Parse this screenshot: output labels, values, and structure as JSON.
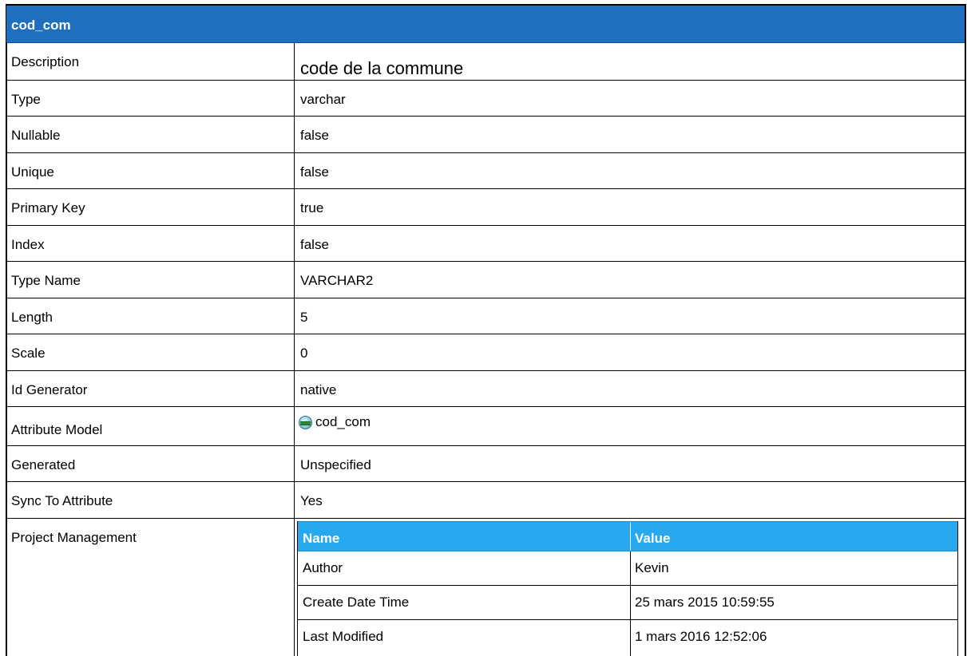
{
  "title": "cod_com",
  "properties": [
    {
      "label": "Description",
      "value": "code de la commune"
    },
    {
      "label": "Type",
      "value": "varchar"
    },
    {
      "label": "Nullable",
      "value": "false"
    },
    {
      "label": "Unique",
      "value": "false"
    },
    {
      "label": "Primary Key",
      "value": "true"
    },
    {
      "label": "Index",
      "value": "false"
    },
    {
      "label": "Type Name",
      "value": "VARCHAR2"
    },
    {
      "label": "Length",
      "value": "5"
    },
    {
      "label": "Scale",
      "value": "0"
    },
    {
      "label": "Id Generator",
      "value": "native"
    },
    {
      "label": "Attribute Model",
      "value": "cod_com",
      "icon": "attribute-icon"
    },
    {
      "label": "Generated",
      "value": "Unspecified"
    },
    {
      "label": "Sync To Attribute",
      "value": "Yes"
    }
  ],
  "project_management": {
    "label": "Project Management",
    "headers": {
      "name": "Name",
      "value": "Value"
    },
    "rows": [
      {
        "name": "Author",
        "value": "Kevin"
      },
      {
        "name": "Create Date Time",
        "value": "25 mars 2015 10:59:55"
      },
      {
        "name": "Last Modified",
        "value": "1 mars 2016 12:52:06"
      }
    ]
  },
  "colors": {
    "title_bar": "#1e6fbf",
    "nested_header": "#28a8ef"
  }
}
